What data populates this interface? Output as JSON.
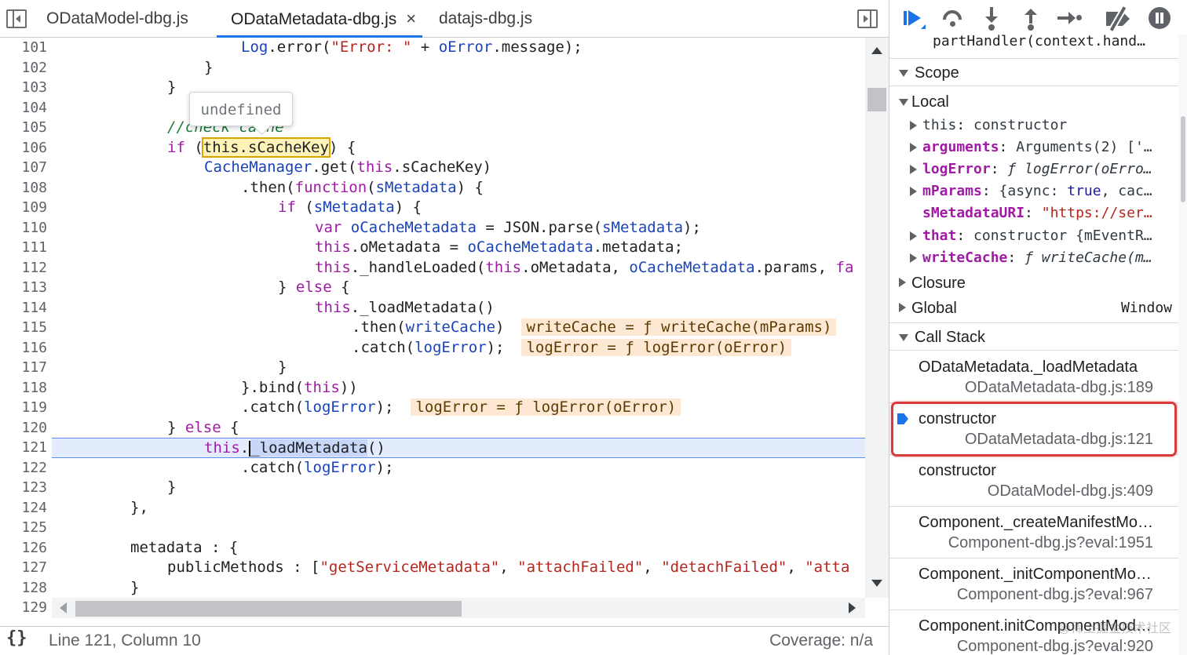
{
  "tabs": [
    {
      "label": "ODataModel-dbg.js",
      "active": false
    },
    {
      "label": "ODataMetadata-dbg.js",
      "active": true,
      "close": "×"
    },
    {
      "label": "datajs-dbg.js",
      "active": false
    }
  ],
  "tooltip": {
    "text": "undefined"
  },
  "code": {
    "line_numbers": [
      "101",
      "102",
      "103",
      "104",
      "105",
      "106",
      "107",
      "108",
      "109",
      "110",
      "111",
      "112",
      "113",
      "114",
      "115",
      "116",
      "117",
      "118",
      "119",
      "120",
      "121",
      "122",
      "123",
      "124",
      "125",
      "126",
      "127",
      "128",
      "129"
    ],
    "current_line": "121",
    "tokens": {
      "l101": [
        "Log",
        ".error(",
        "\"Error: \"",
        " + ",
        "oError",
        ".message);"
      ],
      "l102": [
        "}"
      ],
      "l103": [
        "}"
      ],
      "l105": [
        "//check cache"
      ],
      "l106": [
        "if",
        " (",
        "this.sCacheKey",
        ") {"
      ],
      "l107": [
        "CacheManager",
        ".get(",
        "this",
        ".sCacheKey)"
      ],
      "l108": [
        ".then(",
        "function",
        "(",
        "sMetadata",
        ") {"
      ],
      "l109": [
        "if",
        " (",
        "sMetadata",
        ") {"
      ],
      "l110": [
        "var",
        " ",
        "oCacheMetadata",
        " = JSON.parse(",
        "sMetadata",
        ");"
      ],
      "l111": [
        "this",
        ".oMetadata = ",
        "oCacheMetadata",
        ".metadata;"
      ],
      "l112": [
        "this",
        "._handleLoaded(",
        "this",
        ".oMetadata, ",
        "oCacheMetadata",
        ".params, ",
        "fa"
      ],
      "l113": [
        "} ",
        "else",
        " {"
      ],
      "l114": [
        "this",
        "._loadMetadata()"
      ],
      "l115": [
        ".then(",
        "writeCache",
        ")",
        "writeCache = ƒ writeCache(mParams)"
      ],
      "l116": [
        ".catch(",
        "logError",
        ");",
        "logError = ƒ logError(oError)"
      ],
      "l117": [
        "}"
      ],
      "l118": [
        "}.bind(",
        "this",
        "))"
      ],
      "l119": [
        ".catch(",
        "logError",
        ");",
        "logError = ƒ logError(oError)"
      ],
      "l120": [
        "} ",
        "else",
        " {"
      ],
      "l121": [
        "this",
        ".",
        "_loadMetadata",
        "()"
      ],
      "l122": [
        ".catch(",
        "logError",
        ");"
      ],
      "l123": [
        "}"
      ],
      "l124": [
        "},"
      ],
      "l126": [
        "metadata : {"
      ],
      "l127": [
        "publicMethods : [",
        "\"getServiceMetadata\"",
        ", ",
        "\"attachFailed\"",
        ", ",
        "\"detachFailed\"",
        ", ",
        "\"atta"
      ],
      "l128": [
        "}"
      ]
    }
  },
  "status": {
    "format_icon": "{}",
    "position": "Line 121, Column 10",
    "coverage": "Coverage: n/a"
  },
  "sidebar": {
    "truncated_call": "partHandler(context.hand…",
    "scope": {
      "title": "Scope",
      "local_title": "Local",
      "items": [
        {
          "name": "this",
          "sep": ": ",
          "value": "constructor"
        },
        {
          "name": "arguments",
          "sep": ": ",
          "value": "Arguments(2) ['…"
        },
        {
          "name": "logError",
          "sep": ": ",
          "value": "ƒ logError(oErro…"
        },
        {
          "name": "mParams",
          "sep": ": ",
          "value_a": "{async: ",
          "value_b": "true",
          "value_c": ", cac…"
        },
        {
          "name": "sMetadataURI",
          "sep": ": ",
          "value": "\"https://ser…"
        },
        {
          "name": "that",
          "sep": ": ",
          "value": "constructor {mEventR…"
        },
        {
          "name": "writeCache",
          "sep": ": ",
          "value": "ƒ writeCache(m…"
        }
      ],
      "closure": "Closure",
      "global": "Global",
      "global_value": "Window"
    },
    "callstack": {
      "title": "Call Stack",
      "frames": [
        {
          "name": "ODataMetadata._loadMetadata",
          "loc": "ODataMetadata-dbg.js:189"
        },
        {
          "name": "constructor",
          "loc": "ODataMetadata-dbg.js:121"
        },
        {
          "name": "constructor",
          "loc": "ODataModel-dbg.js:409"
        },
        {
          "name": "Component._createManifestMo…",
          "loc": "Component-dbg.js?eval:1951"
        },
        {
          "name": "Component._initComponentMo…",
          "loc": "Component-dbg.js?eval:967"
        },
        {
          "name": "Component.initComponentMod…",
          "loc": "Component-dbg.js?eval:920"
        }
      ]
    }
  },
  "watermark": "@稀土掘金技术社区",
  "colors": {
    "accent": "#1a73e8",
    "highlight_border": "#d93a3a"
  }
}
